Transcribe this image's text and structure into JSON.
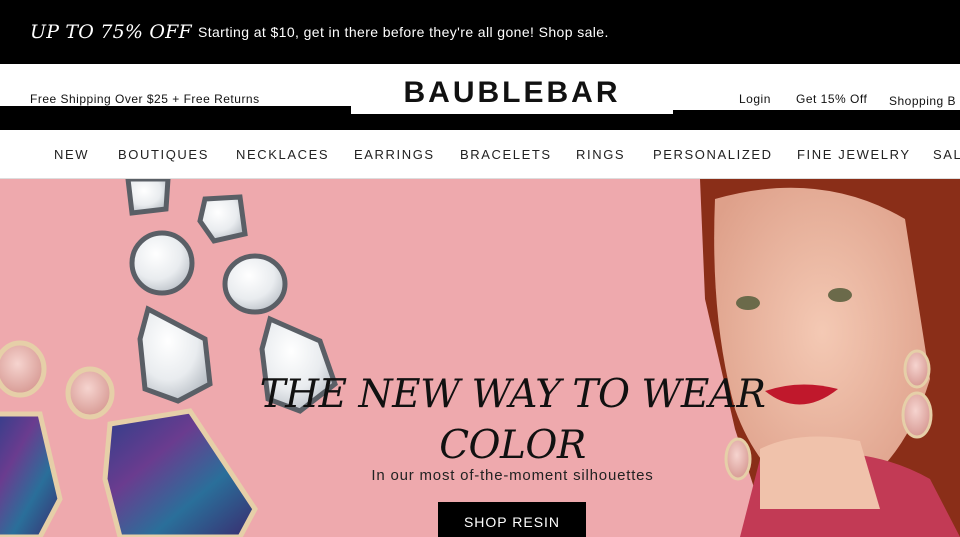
{
  "promo": {
    "headline": "UP TO 75% OFF",
    "text": "Starting at $10, get in there before they're all gone! Shop sale."
  },
  "header": {
    "free_shipping": "Free Shipping Over $25 + Free Returns",
    "logo": "BAUBLEBAR",
    "login": "Login",
    "offer": "Get 15% Off",
    "bag": "Shopping B"
  },
  "nav": {
    "items": [
      "NEW",
      "BOUTIQUES",
      "NECKLACES",
      "EARRINGS",
      "BRACELETS",
      "RINGS",
      "PERSONALIZED",
      "FINE JEWELRY",
      "SAL"
    ]
  },
  "hero": {
    "title_line1": "THE NEW WAY TO WEAR",
    "title_line2": "COLOR",
    "subtitle": "In our most of-the-moment silhouettes",
    "button": "SHOP RESIN"
  },
  "colors": {
    "hero_bg": "#eea9ad",
    "promo_bg": "#000000"
  }
}
